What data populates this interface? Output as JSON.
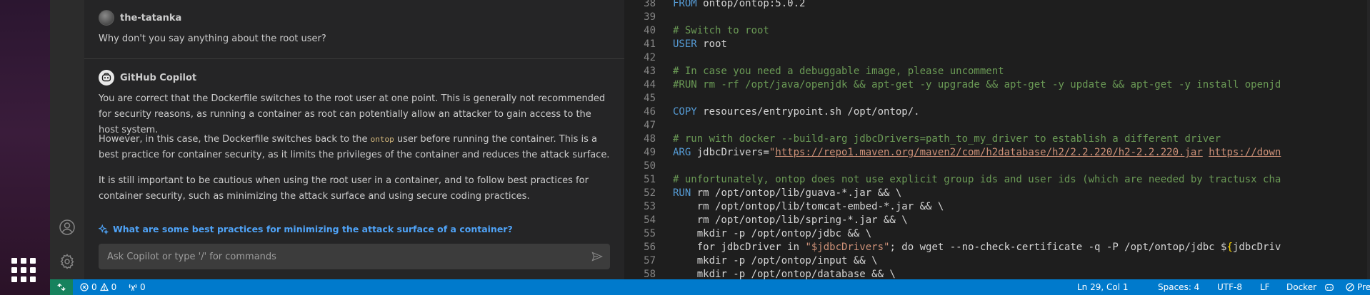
{
  "chat": {
    "messages": [
      {
        "author": "the-tatanka",
        "text": "Why don't you say anything about the root user?"
      },
      {
        "author": "GitHub Copilot",
        "p1": "You are correct that the Dockerfile switches to the root user at one point. This is generally not recommended for security reasons, as running a container as root can potentially allow an attacker to gain access to the host system.",
        "p2_before": "However, in this case, the Dockerfile switches back to the ",
        "p2_code": "ontop",
        "p2_after": " user before running the container. This is a best practice for container security, as it limits the privileges of the container and reduces the attack surface.",
        "p3": "It is still important to be cautious when using the root user in a container, and to follow best practices for container security, such as minimizing the attack surface and using secure coding practices."
      }
    ],
    "suggestion": "What are some best practices for minimizing the attack surface of a container?",
    "input_placeholder": "Ask Copilot or type '/' for commands",
    "icons": [
      "person-avatar-icon",
      "copilot-icon",
      "sparkle-icon",
      "send-icon",
      "account-icon",
      "gear-icon"
    ]
  },
  "editor": {
    "lines": [
      {
        "n": "38",
        "kw": "FROM",
        "rest": " ontop/ontop:5.0.2"
      },
      {
        "n": "39",
        "rest": ""
      },
      {
        "n": "40",
        "comment": "# Switch to root"
      },
      {
        "n": "41",
        "kw": "USER",
        "rest": " root"
      },
      {
        "n": "42",
        "rest": ""
      },
      {
        "n": "43",
        "comment": "# In case you need a debuggable image, please uncomment"
      },
      {
        "n": "44",
        "comment": "#RUN rm -rf /opt/java/openjdk && apt-get -y upgrade && apt-get -y update && apt-get -y install openjd"
      },
      {
        "n": "45",
        "rest": ""
      },
      {
        "n": "46",
        "kw": "COPY",
        "rest": " resources/entrypoint.sh /opt/ontop/."
      },
      {
        "n": "47",
        "rest": ""
      },
      {
        "n": "48",
        "comment": "# run with docker --build-arg jdbcDrivers=path_to_my_driver to establish a different driver"
      },
      {
        "n": "49",
        "kw": "ARG",
        "rest": " jdbcDrivers=",
        "quote": "\"",
        "str1": "https://repo1.maven.org/maven2/com/h2database/h2/2.2.220/h2-2.2.220.jar",
        "space": " ",
        "str2": "https://down"
      },
      {
        "n": "50",
        "rest": ""
      },
      {
        "n": "51",
        "comment": "# unfortunately, ontop does not use explicit group ids and user ids (which are needed by tractusx cha"
      },
      {
        "n": "52",
        "kw": "RUN",
        "rest": " rm /opt/ontop/lib/guava-*.jar && \\"
      },
      {
        "n": "53",
        "rest": "    rm /opt/ontop/lib/tomcat-embed-*.jar && \\"
      },
      {
        "n": "54",
        "rest": "    rm /opt/ontop/lib/spring-*.jar && \\"
      },
      {
        "n": "55",
        "rest": "    mkdir -p /opt/ontop/jdbc && \\"
      },
      {
        "n": "56",
        "pre": "    for jdbcDriver in ",
        "strq": "\"$jdbcDrivers\"",
        "mid": "; do wget --no-check-certificate -q -P /opt/ontop/jdbc $",
        "brace": "{",
        "post": "jdbcDriv"
      },
      {
        "n": "57",
        "rest": "    mkdir -p /opt/ontop/input && \\"
      },
      {
        "n": "58",
        "rest": "    mkdir -p /opt/ontop/database && \\"
      }
    ]
  },
  "statusbar": {
    "errors": "0",
    "warnings": "0",
    "ports": "0",
    "position": "Ln 29, Col 1",
    "spaces": "Spaces: 4",
    "encoding": "UTF-8",
    "eol": "LF",
    "language": "Docker",
    "formatter": "Prettier",
    "colors": {
      "bg": "#007acc",
      "remote": "#16825d"
    }
  }
}
